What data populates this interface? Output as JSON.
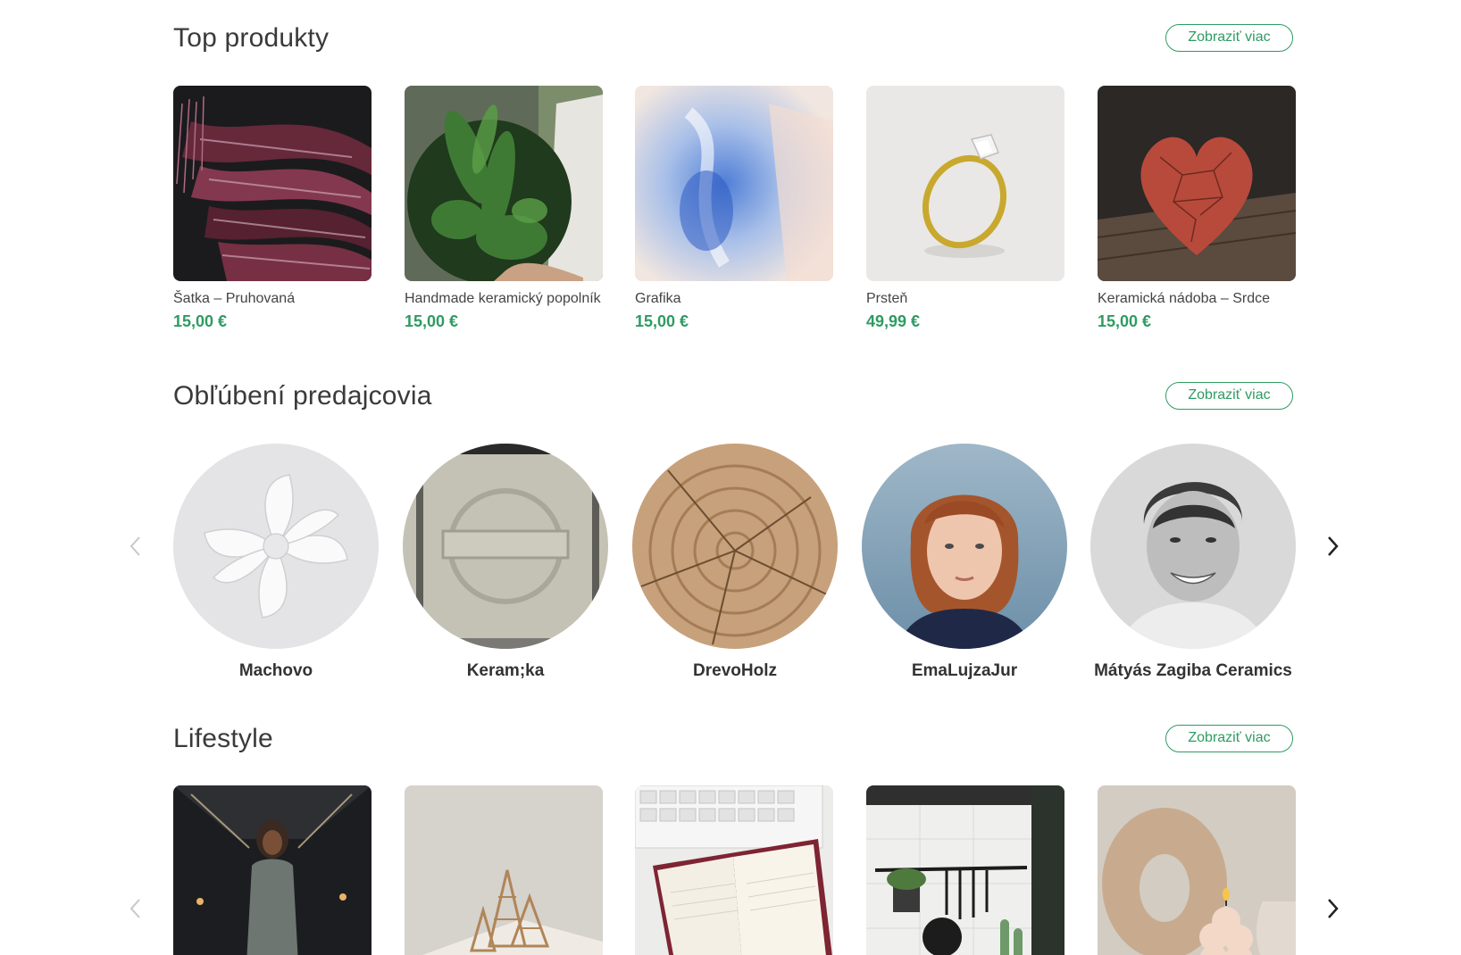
{
  "top_products": {
    "title": "Top produkty",
    "more_label": "Zobraziť viac",
    "items": [
      {
        "name": "Šatka – Pruhovaná",
        "price": "15,00 €"
      },
      {
        "name": "Handmade keramický popolník",
        "price": "15,00 €"
      },
      {
        "name": "Grafika",
        "price": "15,00 €"
      },
      {
        "name": "Prsteň",
        "price": "49,99 €"
      },
      {
        "name": "Keramická nádoba – Srdce",
        "price": "15,00 €"
      }
    ]
  },
  "sellers": {
    "title": "Obľúbení predajcovia",
    "more_label": "Zobraziť viac",
    "items": [
      {
        "name": "Machovo"
      },
      {
        "name": "Keram;ka"
      },
      {
        "name": "DrevoHolz"
      },
      {
        "name": "EmaLujzaJur"
      },
      {
        "name": "Mátyás Zagiba Ceramics"
      }
    ]
  },
  "lifestyle": {
    "title": "Lifestyle",
    "more_label": "Zobraziť viac"
  },
  "icons": {
    "prev": "chevron-left-icon",
    "next": "chevron-right-icon"
  },
  "colors": {
    "accent": "#2e9b62",
    "text": "#333333"
  }
}
